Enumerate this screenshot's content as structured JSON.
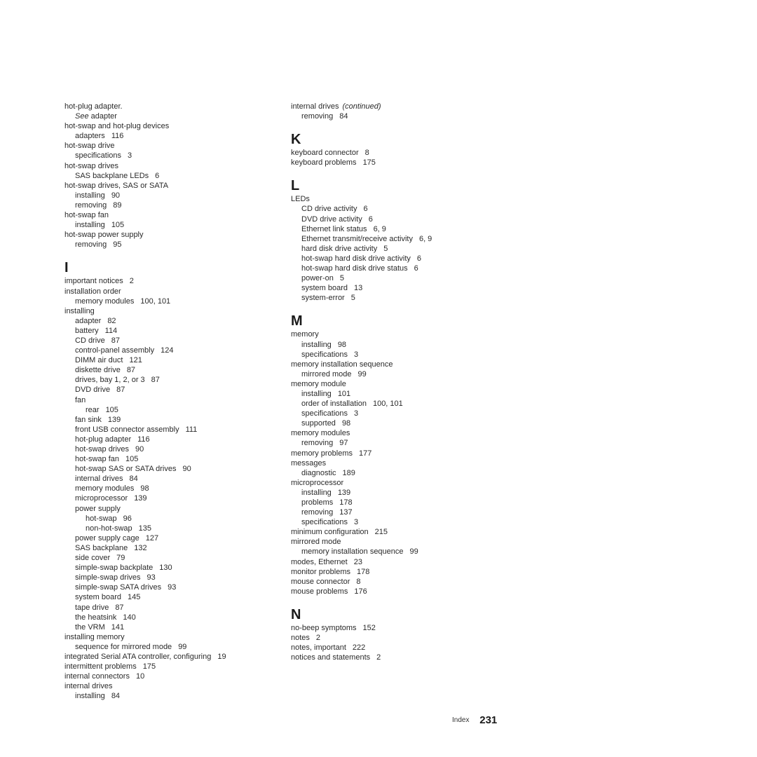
{
  "left_column": [
    {
      "type": "entry",
      "level": 1,
      "text": "hot-plug adapter.",
      "pages": ""
    },
    {
      "type": "see",
      "level": 2,
      "see": "See",
      "text": "adapter"
    },
    {
      "type": "entry",
      "level": 1,
      "text": "hot-swap and hot-plug devices",
      "pages": ""
    },
    {
      "type": "entry",
      "level": 2,
      "text": "adapters",
      "pages": "116"
    },
    {
      "type": "entry",
      "level": 1,
      "text": "hot-swap drive",
      "pages": ""
    },
    {
      "type": "entry",
      "level": 2,
      "text": "specifications",
      "pages": "3"
    },
    {
      "type": "entry",
      "level": 1,
      "text": "hot-swap drives",
      "pages": ""
    },
    {
      "type": "entry",
      "level": 2,
      "text": "SAS backplane LEDs",
      "pages": "6"
    },
    {
      "type": "entry",
      "level": 1,
      "text": "hot-swap drives, SAS or SATA",
      "pages": ""
    },
    {
      "type": "entry",
      "level": 2,
      "text": "installing",
      "pages": "90"
    },
    {
      "type": "entry",
      "level": 2,
      "text": "removing",
      "pages": "89"
    },
    {
      "type": "entry",
      "level": 1,
      "text": "hot-swap fan",
      "pages": ""
    },
    {
      "type": "entry",
      "level": 2,
      "text": "installing",
      "pages": "105"
    },
    {
      "type": "entry",
      "level": 1,
      "text": "hot-swap power supply",
      "pages": ""
    },
    {
      "type": "entry",
      "level": 2,
      "text": "removing",
      "pages": "95"
    },
    {
      "type": "letter",
      "text": "I"
    },
    {
      "type": "entry",
      "level": 1,
      "text": "important notices",
      "pages": "2"
    },
    {
      "type": "entry",
      "level": 1,
      "text": "installation order",
      "pages": ""
    },
    {
      "type": "entry",
      "level": 2,
      "text": "memory modules",
      "pages": "100, 101"
    },
    {
      "type": "entry",
      "level": 1,
      "text": "installing",
      "pages": ""
    },
    {
      "type": "entry",
      "level": 2,
      "text": "adapter",
      "pages": "82"
    },
    {
      "type": "entry",
      "level": 2,
      "text": "battery",
      "pages": "114"
    },
    {
      "type": "entry",
      "level": 2,
      "text": "CD drive",
      "pages": "87"
    },
    {
      "type": "entry",
      "level": 2,
      "text": "control-panel assembly",
      "pages": "124"
    },
    {
      "type": "entry",
      "level": 2,
      "text": "DIMM air duct",
      "pages": "121"
    },
    {
      "type": "entry",
      "level": 2,
      "text": "diskette drive",
      "pages": "87"
    },
    {
      "type": "entry",
      "level": 2,
      "text": "drives, bay 1, 2, or 3",
      "pages": "87"
    },
    {
      "type": "entry",
      "level": 2,
      "text": "DVD drive",
      "pages": "87"
    },
    {
      "type": "entry",
      "level": 2,
      "text": "fan",
      "pages": ""
    },
    {
      "type": "entry",
      "level": 3,
      "text": "rear",
      "pages": "105"
    },
    {
      "type": "entry",
      "level": 2,
      "text": "fan sink",
      "pages": "139"
    },
    {
      "type": "entry",
      "level": 2,
      "text": "front USB connector assembly",
      "pages": "111"
    },
    {
      "type": "entry",
      "level": 2,
      "text": "hot-plug adapter",
      "pages": "116"
    },
    {
      "type": "entry",
      "level": 2,
      "text": "hot-swap drives",
      "pages": "90"
    },
    {
      "type": "entry",
      "level": 2,
      "text": "hot-swap fan",
      "pages": "105"
    },
    {
      "type": "entry",
      "level": 2,
      "text": "hot-swap SAS or SATA drives",
      "pages": "90"
    },
    {
      "type": "entry",
      "level": 2,
      "text": "internal drives",
      "pages": "84"
    },
    {
      "type": "entry",
      "level": 2,
      "text": "memory modules",
      "pages": "98"
    },
    {
      "type": "entry",
      "level": 2,
      "text": "microprocessor",
      "pages": "139"
    },
    {
      "type": "entry",
      "level": 2,
      "text": "power supply",
      "pages": ""
    },
    {
      "type": "entry",
      "level": 3,
      "text": "hot-swap",
      "pages": "96"
    },
    {
      "type": "entry",
      "level": 3,
      "text": "non-hot-swap",
      "pages": "135"
    },
    {
      "type": "entry",
      "level": 2,
      "text": "power supply cage",
      "pages": "127"
    },
    {
      "type": "entry",
      "level": 2,
      "text": "SAS backplane",
      "pages": "132"
    },
    {
      "type": "entry",
      "level": 2,
      "text": "side cover",
      "pages": "79"
    },
    {
      "type": "entry",
      "level": 2,
      "text": "simple-swap backplate",
      "pages": "130"
    },
    {
      "type": "entry",
      "level": 2,
      "text": "simple-swap drives",
      "pages": "93"
    },
    {
      "type": "entry",
      "level": 2,
      "text": "simple-swap SATA drives",
      "pages": "93"
    },
    {
      "type": "entry",
      "level": 2,
      "text": "system board",
      "pages": "145"
    },
    {
      "type": "entry",
      "level": 2,
      "text": "tape drive",
      "pages": "87"
    },
    {
      "type": "entry",
      "level": 2,
      "text": "the heatsink",
      "pages": "140"
    },
    {
      "type": "entry",
      "level": 2,
      "text": "the VRM",
      "pages": "141"
    },
    {
      "type": "entry",
      "level": 1,
      "text": "installing memory",
      "pages": ""
    },
    {
      "type": "entry",
      "level": 2,
      "text": "sequence for mirrored mode",
      "pages": "99"
    },
    {
      "type": "entry",
      "level": 1,
      "text": "integrated Serial ATA controller, configuring",
      "pages": "19"
    },
    {
      "type": "entry",
      "level": 1,
      "text": "intermittent problems",
      "pages": "175"
    },
    {
      "type": "entry",
      "level": 1,
      "text": "internal connectors",
      "pages": "10"
    },
    {
      "type": "entry",
      "level": 1,
      "text": "internal drives",
      "pages": ""
    },
    {
      "type": "entry",
      "level": 2,
      "text": "installing",
      "pages": "84"
    }
  ],
  "right_column": [
    {
      "type": "continued",
      "level": 1,
      "text": "internal drives",
      "note": "(continued)"
    },
    {
      "type": "entry",
      "level": 2,
      "text": "removing",
      "pages": "84"
    },
    {
      "type": "letter",
      "text": "K"
    },
    {
      "type": "entry",
      "level": 1,
      "text": "keyboard connector",
      "pages": "8"
    },
    {
      "type": "entry",
      "level": 1,
      "text": "keyboard problems",
      "pages": "175"
    },
    {
      "type": "letter",
      "text": "L"
    },
    {
      "type": "entry",
      "level": 1,
      "text": "LEDs",
      "pages": ""
    },
    {
      "type": "entry",
      "level": 2,
      "text": "CD drive activity",
      "pages": "6"
    },
    {
      "type": "entry",
      "level": 2,
      "text": "DVD drive activity",
      "pages": "6"
    },
    {
      "type": "entry",
      "level": 2,
      "text": "Ethernet link status",
      "pages": "6, 9"
    },
    {
      "type": "entry",
      "level": 2,
      "text": "Ethernet transmit/receive activity",
      "pages": "6, 9"
    },
    {
      "type": "entry",
      "level": 2,
      "text": "hard disk drive activity",
      "pages": "5"
    },
    {
      "type": "entry",
      "level": 2,
      "text": "hot-swap hard disk drive activity",
      "pages": "6"
    },
    {
      "type": "entry",
      "level": 2,
      "text": "hot-swap hard disk drive status",
      "pages": "6"
    },
    {
      "type": "entry",
      "level": 2,
      "text": "power-on",
      "pages": "5"
    },
    {
      "type": "entry",
      "level": 2,
      "text": "system board",
      "pages": "13"
    },
    {
      "type": "entry",
      "level": 2,
      "text": "system-error",
      "pages": "5"
    },
    {
      "type": "letter",
      "text": "M"
    },
    {
      "type": "entry",
      "level": 1,
      "text": "memory",
      "pages": ""
    },
    {
      "type": "entry",
      "level": 2,
      "text": "installing",
      "pages": "98"
    },
    {
      "type": "entry",
      "level": 2,
      "text": "specifications",
      "pages": "3"
    },
    {
      "type": "entry",
      "level": 1,
      "text": "memory installation sequence",
      "pages": ""
    },
    {
      "type": "entry",
      "level": 2,
      "text": "mirrored mode",
      "pages": "99"
    },
    {
      "type": "entry",
      "level": 1,
      "text": "memory module",
      "pages": ""
    },
    {
      "type": "entry",
      "level": 2,
      "text": "installing",
      "pages": "101"
    },
    {
      "type": "entry",
      "level": 2,
      "text": "order of installation",
      "pages": "100, 101"
    },
    {
      "type": "entry",
      "level": 2,
      "text": "specifications",
      "pages": "3"
    },
    {
      "type": "entry",
      "level": 2,
      "text": "supported",
      "pages": "98"
    },
    {
      "type": "entry",
      "level": 1,
      "text": "memory modules",
      "pages": ""
    },
    {
      "type": "entry",
      "level": 2,
      "text": "removing",
      "pages": "97"
    },
    {
      "type": "entry",
      "level": 1,
      "text": "memory problems",
      "pages": "177"
    },
    {
      "type": "entry",
      "level": 1,
      "text": "messages",
      "pages": ""
    },
    {
      "type": "entry",
      "level": 2,
      "text": "diagnostic",
      "pages": "189"
    },
    {
      "type": "entry",
      "level": 1,
      "text": "microprocessor",
      "pages": ""
    },
    {
      "type": "entry",
      "level": 2,
      "text": "installing",
      "pages": "139"
    },
    {
      "type": "entry",
      "level": 2,
      "text": "problems",
      "pages": "178"
    },
    {
      "type": "entry",
      "level": 2,
      "text": "removing",
      "pages": "137"
    },
    {
      "type": "entry",
      "level": 2,
      "text": "specifications",
      "pages": "3"
    },
    {
      "type": "entry",
      "level": 1,
      "text": "minimum configuration",
      "pages": "215"
    },
    {
      "type": "entry",
      "level": 1,
      "text": "mirrored mode",
      "pages": ""
    },
    {
      "type": "entry",
      "level": 2,
      "text": "memory installation sequence",
      "pages": "99"
    },
    {
      "type": "entry",
      "level": 1,
      "text": "modes, Ethernet",
      "pages": "23"
    },
    {
      "type": "entry",
      "level": 1,
      "text": "monitor problems",
      "pages": "178"
    },
    {
      "type": "entry",
      "level": 1,
      "text": "mouse connector",
      "pages": "8"
    },
    {
      "type": "entry",
      "level": 1,
      "text": "mouse problems",
      "pages": "176"
    },
    {
      "type": "letter",
      "text": "N"
    },
    {
      "type": "entry",
      "level": 1,
      "text": "no-beep symptoms",
      "pages": "152"
    },
    {
      "type": "entry",
      "level": 1,
      "text": "notes",
      "pages": "2"
    },
    {
      "type": "entry",
      "level": 1,
      "text": "notes, important",
      "pages": "222"
    },
    {
      "type": "entry",
      "level": 1,
      "text": "notices and statements",
      "pages": "2"
    }
  ],
  "footer": {
    "label": "Index",
    "page_number": "231"
  }
}
